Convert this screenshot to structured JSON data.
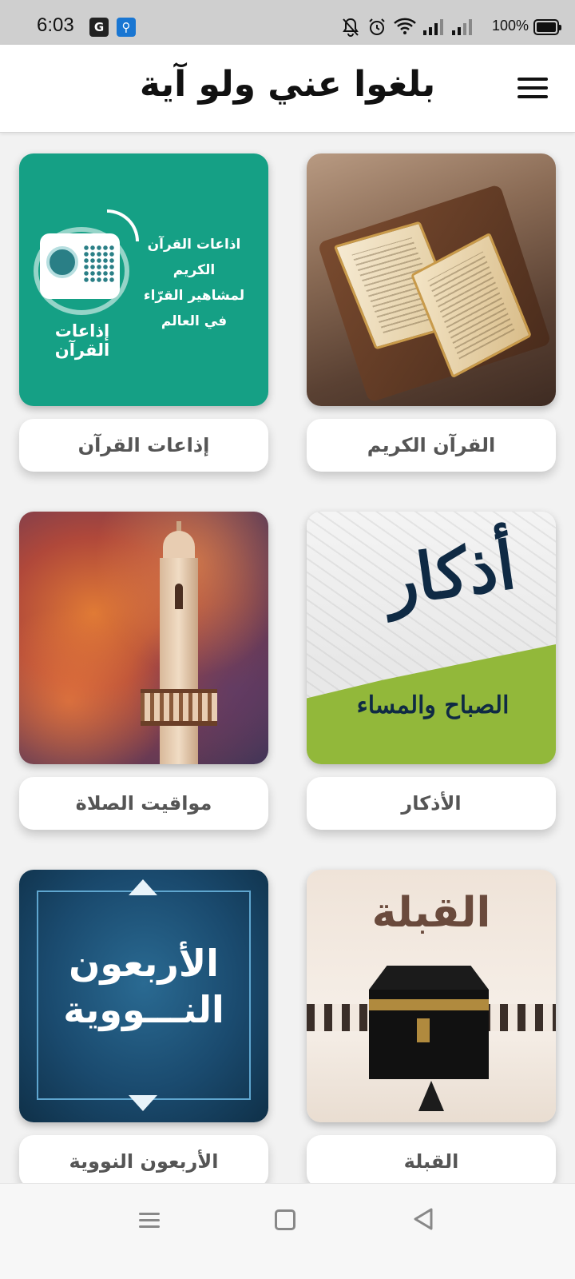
{
  "status_bar": {
    "time": "6:03",
    "battery": "100%",
    "icons": [
      "translate-icon",
      "usb-icon",
      "bell-off-icon",
      "alarm-icon",
      "wifi-icon",
      "signal-icon",
      "signal-icon",
      "battery-icon"
    ]
  },
  "app_bar": {
    "title": "بلغوا عني ولو آية",
    "menu_icon": "hamburger-menu-icon"
  },
  "tiles": [
    {
      "label": "القرآن الكريم",
      "image": "open-quran-book"
    },
    {
      "label": "إذاعات القرآن",
      "image": "radio-illustration",
      "image_text": [
        "اذاعات القرآن الكريم",
        "لمشاهير القرّاء",
        "في العالم"
      ],
      "image_caption": "إذاعات القرآن"
    },
    {
      "label": "الأذكار",
      "image": "azkar-calligraphy",
      "image_text": [
        "أذكار",
        "الصباح والمساء"
      ]
    },
    {
      "label": "مواقيت الصلاة",
      "image": "minaret-sunset"
    },
    {
      "label": "القبلة",
      "image": "kaaba-illustration",
      "image_text": [
        "القبلة"
      ]
    },
    {
      "label": "الأربعون النووية",
      "image": "nawawi-cover",
      "image_text": [
        "الأربعون",
        "النـــووية"
      ]
    }
  ],
  "bottom_nav": {
    "items": [
      "menu-icon",
      "home-icon",
      "back-icon"
    ]
  }
}
